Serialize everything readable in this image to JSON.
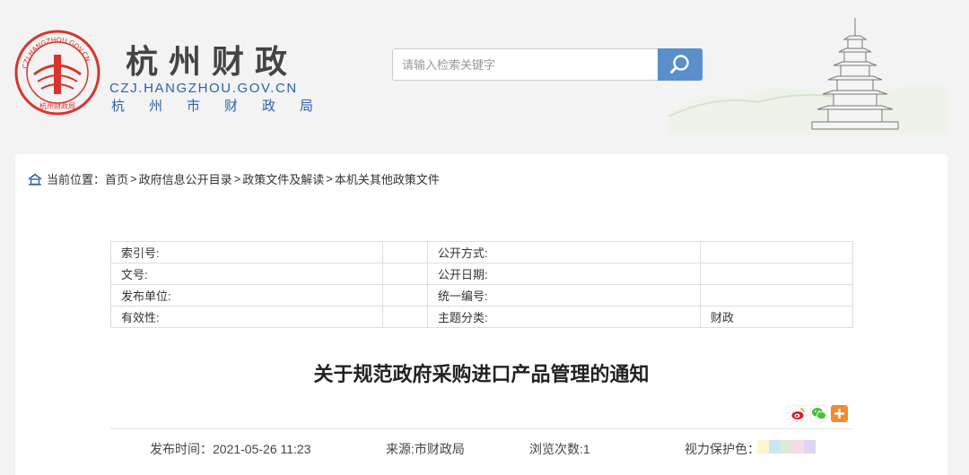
{
  "header": {
    "site_name": "杭州财政",
    "domain": "CZJ.HANGZHOU.GOV.CN",
    "site_sub": "杭州市财政局",
    "emblem_text": "CZJ.HANGZHOU.GOV.CN",
    "emblem_bottom": "杭州财政局"
  },
  "search": {
    "placeholder": "请输入检索关键字"
  },
  "breadcrumb": {
    "label": "当前位置：",
    "items": [
      "首页",
      "政府信息公开目录",
      "政策文件及解读",
      "本机关其他政策文件"
    ],
    "separator": ">"
  },
  "meta": {
    "rows": [
      {
        "k1": "索引号:",
        "v1": "",
        "k2": "公开方式:",
        "v2": ""
      },
      {
        "k1": "文号:",
        "v1": "",
        "k2": "公开日期:",
        "v2": ""
      },
      {
        "k1": "发布单位:",
        "v1": "",
        "k2": "统一编号:",
        "v2": ""
      },
      {
        "k1": "有效性:",
        "v1": "",
        "k2": "主题分类:",
        "v2": "财政"
      }
    ]
  },
  "article": {
    "title": "关于规范政府采购进口产品管理的通知",
    "publish_time": "发布时间：2021-05-26 11:23",
    "source": "来源:市财政局",
    "views": "浏览次数:1",
    "eye_care_label": "视力保护色："
  },
  "colors": {
    "accent": "#5a8fcb",
    "brand_red": "#d9342b",
    "link_blue": "#2d62a8",
    "swatches": [
      "#fdf6cf",
      "#c9e7f5",
      "#dcecd4",
      "#f6dde4",
      "#eae0f2",
      "#dcd6f2"
    ]
  },
  "share": [
    "weibo-icon",
    "wechat-icon",
    "more-share-icon"
  ]
}
